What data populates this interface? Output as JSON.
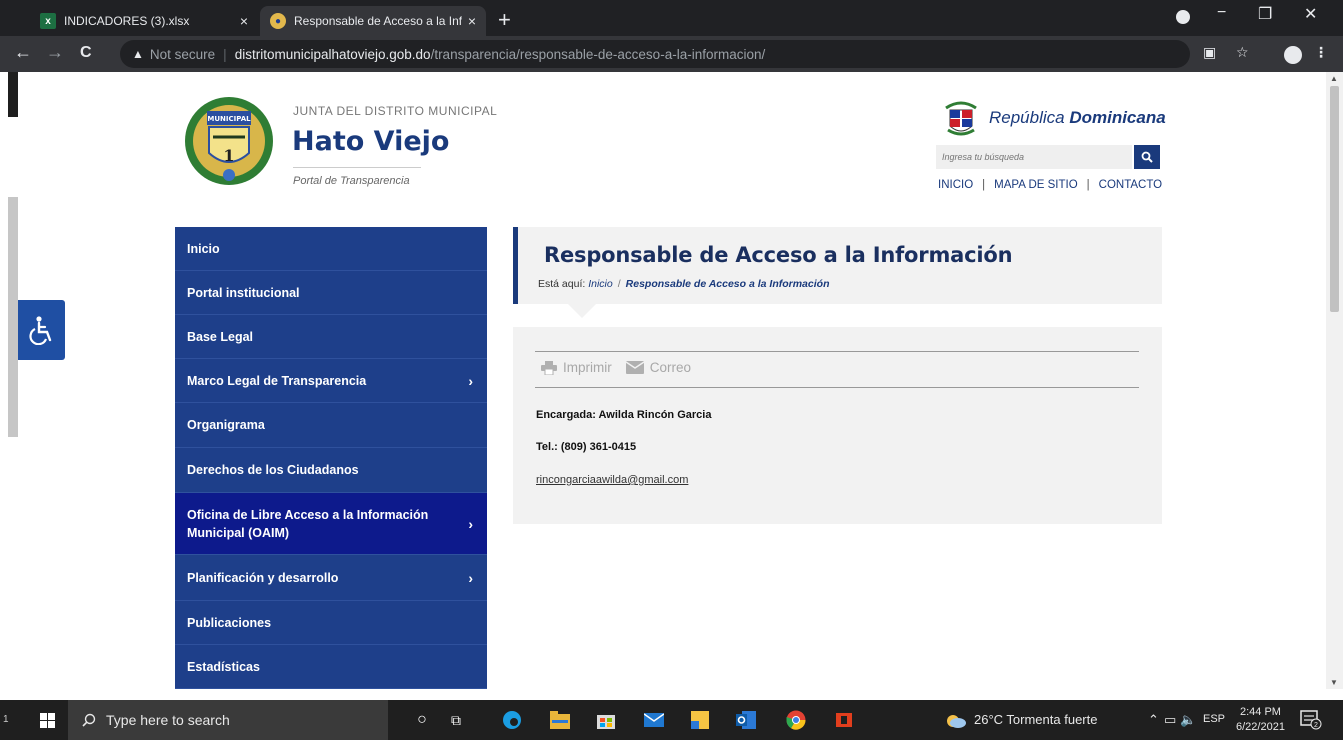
{
  "browser": {
    "tabs": [
      {
        "title": "INDICADORES (3).xlsx",
        "close": "×"
      },
      {
        "title": "Responsable de Acceso a la Infor",
        "close": "×"
      }
    ],
    "new_tab": "+",
    "window_controls": {
      "minimize": "−",
      "maximize": "❐",
      "close": "✕"
    },
    "nav": {
      "back": "←",
      "forward": "→",
      "reload": "C"
    },
    "address": {
      "security": "Not secure",
      "host": "distritomunicipalhatoviejo.gob.do",
      "path": "/transparencia/responsable-de-acceso-a-la-informacion/"
    }
  },
  "site": {
    "header": {
      "subtitle": "JUNTA DEL DISTRITO MUNICIPAL",
      "title": "Hato Viejo",
      "portal": "Portal de Transparencia",
      "seal_text": "MUNICIPAL",
      "republic_prefix": "República ",
      "republic_bold": "Dominicana",
      "search_placeholder": "Ingresa tu búsqueda",
      "links": [
        "INICIO",
        "MAPA DE SITIO",
        "CONTACTO"
      ],
      "link_sep": "|"
    },
    "menu": [
      {
        "label": "Inicio",
        "has_sub": false
      },
      {
        "label": "Portal institucional",
        "has_sub": false
      },
      {
        "label": "Base Legal",
        "has_sub": false
      },
      {
        "label": "Marco Legal de Transparencia",
        "has_sub": true
      },
      {
        "label": "Organigrama",
        "has_sub": false
      },
      {
        "label": "Derechos de los Ciudadanos",
        "has_sub": false
      },
      {
        "label": "Oficina de Libre Acceso a la Información Municipal (OAIM)",
        "has_sub": true,
        "active": true
      },
      {
        "label": "Planificación y desarrollo",
        "has_sub": true
      },
      {
        "label": "Publicaciones",
        "has_sub": false
      },
      {
        "label": "Estadísticas",
        "has_sub": false
      }
    ],
    "menu_chevron": "›",
    "page": {
      "title": "Responsable de Acceso a la Información",
      "breadcrumb_prefix": "Está aquí:",
      "breadcrumb_home": "Inicio",
      "breadcrumb_sep": "/",
      "breadcrumb_current": "Responsable de Acceso a la Información",
      "tools": {
        "print": "Imprimir",
        "email": "Correo"
      },
      "encargada": "Encargada: Awilda Rincón Garcia",
      "tel": "Tel.: (809) 361-0415",
      "email": "rincongarciaawilda@gmail.com"
    }
  },
  "taskbar": {
    "search": "Type here to search",
    "weather": "26°C  Tormenta fuerte",
    "lang": "ESP",
    "time": "2:44 PM",
    "date": "6/22/2021",
    "notif_count": "2",
    "sidebar_edge_label": "1"
  },
  "colors": {
    "brand_blue": "#1a3a7c",
    "menu_blue": "#1e3f8a",
    "menu_active": "#0d1a8c",
    "panel_grey": "#f2f2f2"
  }
}
